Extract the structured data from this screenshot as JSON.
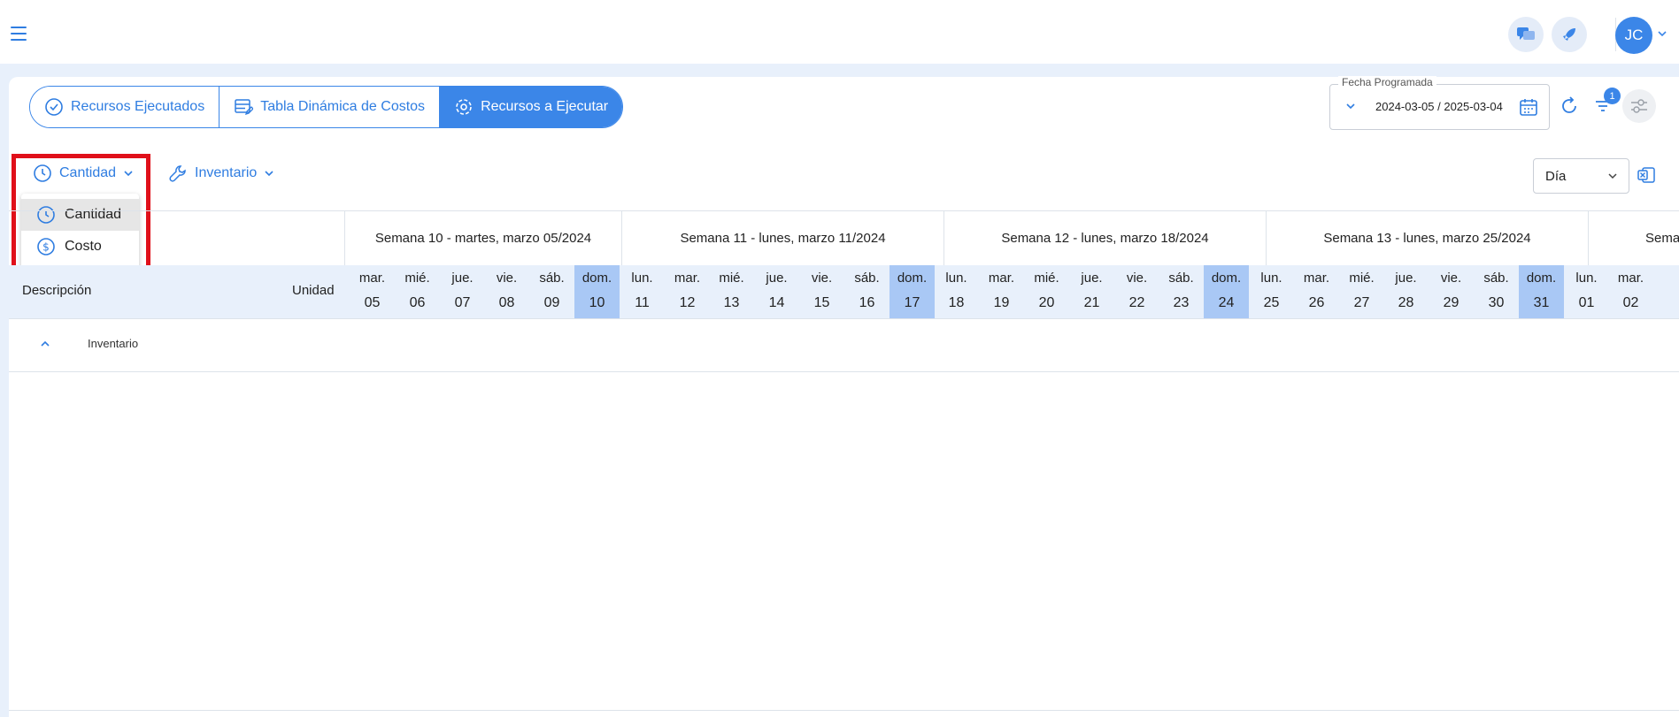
{
  "header": {
    "avatar_initials": "JC"
  },
  "tabs": [
    {
      "label": "Recursos Ejecutados",
      "icon": "check-circle-icon",
      "active": false
    },
    {
      "label": "Tabla Dinámica de Costos",
      "icon": "table-edit-icon",
      "active": false
    },
    {
      "label": "Recursos a Ejecutar",
      "icon": "gear-icon",
      "active": true
    }
  ],
  "date_filter": {
    "label": "Fecha Programada",
    "value": "2024-03-05 / 2025-03-04"
  },
  "filter_badge": "1",
  "metric_select": {
    "value": "Cantidad"
  },
  "metric_menu": [
    {
      "label": "Cantidad",
      "icon": "clock-icon"
    },
    {
      "label": "Costo",
      "icon": "dollar-icon"
    }
  ],
  "inventory_select": {
    "value": "Inventario"
  },
  "period_select": {
    "value": "Día"
  },
  "table": {
    "col_description": "Descripción",
    "col_unit": "Unidad",
    "weeks": [
      "Semana 10 - martes, marzo 05/2024",
      "Semana 11 - lunes, marzo 11/2024",
      "Semana 12 - lunes, marzo 18/2024",
      "Semana 13 - lunes, marzo 25/2024",
      "Sema"
    ],
    "days": [
      {
        "dow": "mar.",
        "num": "05",
        "sun": false
      },
      {
        "dow": "mié.",
        "num": "06",
        "sun": false
      },
      {
        "dow": "jue.",
        "num": "07",
        "sun": false
      },
      {
        "dow": "vie.",
        "num": "08",
        "sun": false
      },
      {
        "dow": "sáb.",
        "num": "09",
        "sun": false
      },
      {
        "dow": "dom.",
        "num": "10",
        "sun": true
      },
      {
        "dow": "lun.",
        "num": "11",
        "sun": false
      },
      {
        "dow": "mar.",
        "num": "12",
        "sun": false
      },
      {
        "dow": "mié.",
        "num": "13",
        "sun": false
      },
      {
        "dow": "jue.",
        "num": "14",
        "sun": false
      },
      {
        "dow": "vie.",
        "num": "15",
        "sun": false
      },
      {
        "dow": "sáb.",
        "num": "16",
        "sun": false
      },
      {
        "dow": "dom.",
        "num": "17",
        "sun": true
      },
      {
        "dow": "lun.",
        "num": "18",
        "sun": false
      },
      {
        "dow": "mar.",
        "num": "19",
        "sun": false
      },
      {
        "dow": "mié.",
        "num": "20",
        "sun": false
      },
      {
        "dow": "jue.",
        "num": "21",
        "sun": false
      },
      {
        "dow": "vie.",
        "num": "22",
        "sun": false
      },
      {
        "dow": "sáb.",
        "num": "23",
        "sun": false
      },
      {
        "dow": "dom.",
        "num": "24",
        "sun": true
      },
      {
        "dow": "lun.",
        "num": "25",
        "sun": false
      },
      {
        "dow": "mar.",
        "num": "26",
        "sun": false
      },
      {
        "dow": "mié.",
        "num": "27",
        "sun": false
      },
      {
        "dow": "jue.",
        "num": "28",
        "sun": false
      },
      {
        "dow": "vie.",
        "num": "29",
        "sun": false
      },
      {
        "dow": "sáb.",
        "num": "30",
        "sun": false
      },
      {
        "dow": "dom.",
        "num": "31",
        "sun": true
      },
      {
        "dow": "lun.",
        "num": "01",
        "sun": false
      },
      {
        "dow": "mar.",
        "num": "02",
        "sun": false
      }
    ],
    "group_row": "Inventario"
  },
  "colors": {
    "accent": "#3b86e8",
    "highlight": "#e0101a",
    "sunday": "#a9c8f5",
    "header_band": "#e8f0fb"
  }
}
